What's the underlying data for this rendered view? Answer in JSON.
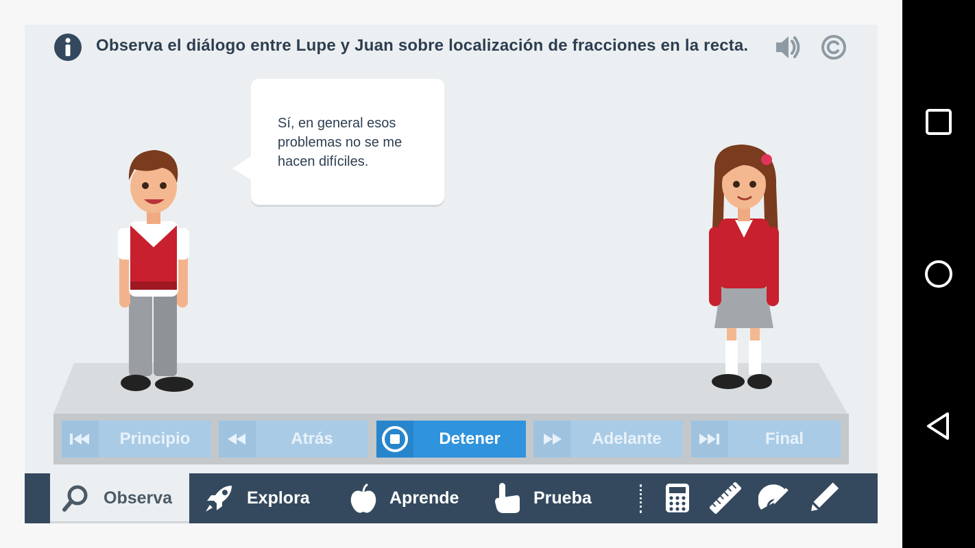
{
  "header": {
    "info_icon": "info-icon",
    "title": "Observa el diálogo entre Lupe y Juan sobre localización de fracciones en la recta.",
    "sound_icon": "speaker-icon",
    "copyright_icon": "copyright-icon"
  },
  "dialog": {
    "speech": "Sí, en general esos problemas no se me hacen difíciles."
  },
  "controls": {
    "buttons": [
      {
        "label": "Principio",
        "icon": "skip-to-start-icon",
        "active": false
      },
      {
        "label": "Atrás",
        "icon": "rewind-icon",
        "active": false
      },
      {
        "label": "Detener",
        "icon": "stop-icon",
        "active": true
      },
      {
        "label": "Adelante",
        "icon": "fast-forward-icon",
        "active": false
      },
      {
        "label": "Final",
        "icon": "skip-to-end-icon",
        "active": false
      }
    ]
  },
  "nav": {
    "items": [
      {
        "label": "Observa",
        "icon": "magnifier-icon",
        "active": true
      },
      {
        "label": "Explora",
        "icon": "rocket-icon",
        "active": false
      },
      {
        "label": "Aprende",
        "icon": "apple-icon",
        "active": false
      },
      {
        "label": "Prueba",
        "icon": "pointing-hand-icon",
        "active": false
      }
    ],
    "tools": [
      "calculator-icon",
      "ruler-icon",
      "protractor-icon",
      "pencil-icon"
    ]
  },
  "system_nav": [
    "recents-square-icon",
    "home-circle-icon",
    "back-triangle-icon"
  ],
  "colors": {
    "accent": "#2f93dd",
    "nav_bar": "#34495e",
    "uniform_red": "#c8202e",
    "text_dark": "#2d3e50"
  }
}
